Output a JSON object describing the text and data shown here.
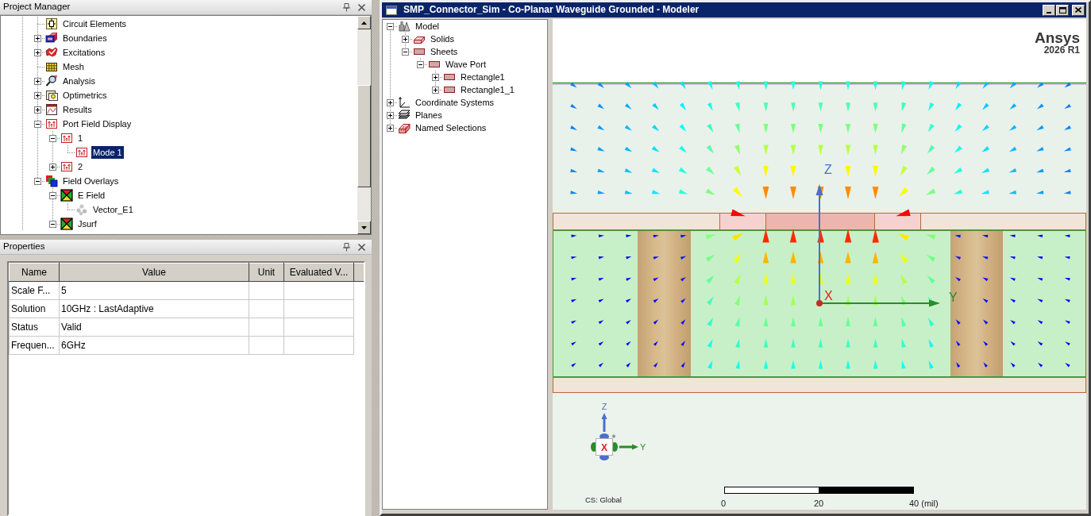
{
  "project_manager": {
    "title": "Project Manager",
    "tree": [
      {
        "label": "Circuit Elements",
        "kind": "circuit",
        "selected": false
      },
      {
        "label": "Boundaries",
        "kind": "boundaries",
        "expanded": false,
        "selected": false
      },
      {
        "label": "Excitations",
        "kind": "excitations",
        "expanded": false,
        "selected": false
      },
      {
        "label": "Mesh",
        "kind": "mesh",
        "selected": false
      },
      {
        "label": "Analysis",
        "kind": "analysis",
        "expanded": false,
        "selected": false
      },
      {
        "label": "Optimetrics",
        "kind": "optimetrics",
        "expanded": false,
        "selected": false
      },
      {
        "label": "Results",
        "kind": "results",
        "expanded": false,
        "selected": false
      },
      {
        "label": "Port Field Display",
        "kind": "portfield",
        "expanded": true,
        "selected": false,
        "children": [
          {
            "label": "1",
            "kind": "portfield",
            "expanded": true,
            "selected": false,
            "children": [
              {
                "label": "Mode 1",
                "kind": "portfield",
                "selected": true
              }
            ]
          },
          {
            "label": "2",
            "kind": "portfield",
            "expanded": false,
            "selected": false
          }
        ]
      },
      {
        "label": "Field Overlays",
        "kind": "overlays",
        "expanded": true,
        "selected": false,
        "children": [
          {
            "label": "E Field",
            "kind": "fieldplot",
            "expanded": true,
            "selected": false,
            "children": [
              {
                "label": "Vector_E1",
                "kind": "vector",
                "selected": false
              }
            ]
          },
          {
            "label": "Jsurf",
            "kind": "fieldplot",
            "expanded": true,
            "selected": false
          }
        ]
      }
    ]
  },
  "properties": {
    "title": "Properties",
    "columns": [
      "Name",
      "Value",
      "Unit",
      "Evaluated V..."
    ],
    "rows": [
      {
        "name": "Scale F...",
        "value": "5"
      },
      {
        "name": "Solution",
        "value": "10GHz : LastAdaptive"
      },
      {
        "name": "Status",
        "value": "Valid"
      },
      {
        "name": "Frequen...",
        "value": "6GHz"
      }
    ]
  },
  "modeler": {
    "title": "SMP_Connector_Sim - Co-Planar Waveguide Grounded - Modeler",
    "tree": [
      {
        "label": "Model",
        "kind": "model",
        "expanded": true,
        "selected": false,
        "children": [
          {
            "label": "Solids",
            "kind": "solids",
            "expanded": false,
            "selected": false
          },
          {
            "label": "Sheets",
            "kind": "sheets",
            "expanded": true,
            "selected": false,
            "children": [
              {
                "label": "Wave Port",
                "kind": "sheets",
                "expanded": true,
                "selected": false,
                "children": [
                  {
                    "label": "Rectangle1",
                    "kind": "sheets",
                    "expanded": false,
                    "selected": false
                  },
                  {
                    "label": "Rectangle1_1",
                    "kind": "sheets",
                    "expanded": false,
                    "selected": false
                  }
                ]
              }
            ]
          }
        ]
      },
      {
        "label": "Coordinate Systems",
        "kind": "coordinates",
        "expanded": false,
        "selected": false
      },
      {
        "label": "Planes",
        "kind": "planes",
        "expanded": false,
        "selected": false
      },
      {
        "label": "Named Selections",
        "kind": "selections",
        "expanded": false,
        "selected": false
      }
    ],
    "viewport": {
      "brand": "Ansys",
      "version": "2026 R1",
      "axes": {
        "z": "Z",
        "x": "X",
        "y": "Y"
      },
      "triad": {
        "z": "Z",
        "x": "X",
        "y": "Y"
      },
      "coordinate_system": "CS: Global",
      "scale_bar": [
        "0",
        "20",
        "40 (mil)"
      ]
    }
  }
}
